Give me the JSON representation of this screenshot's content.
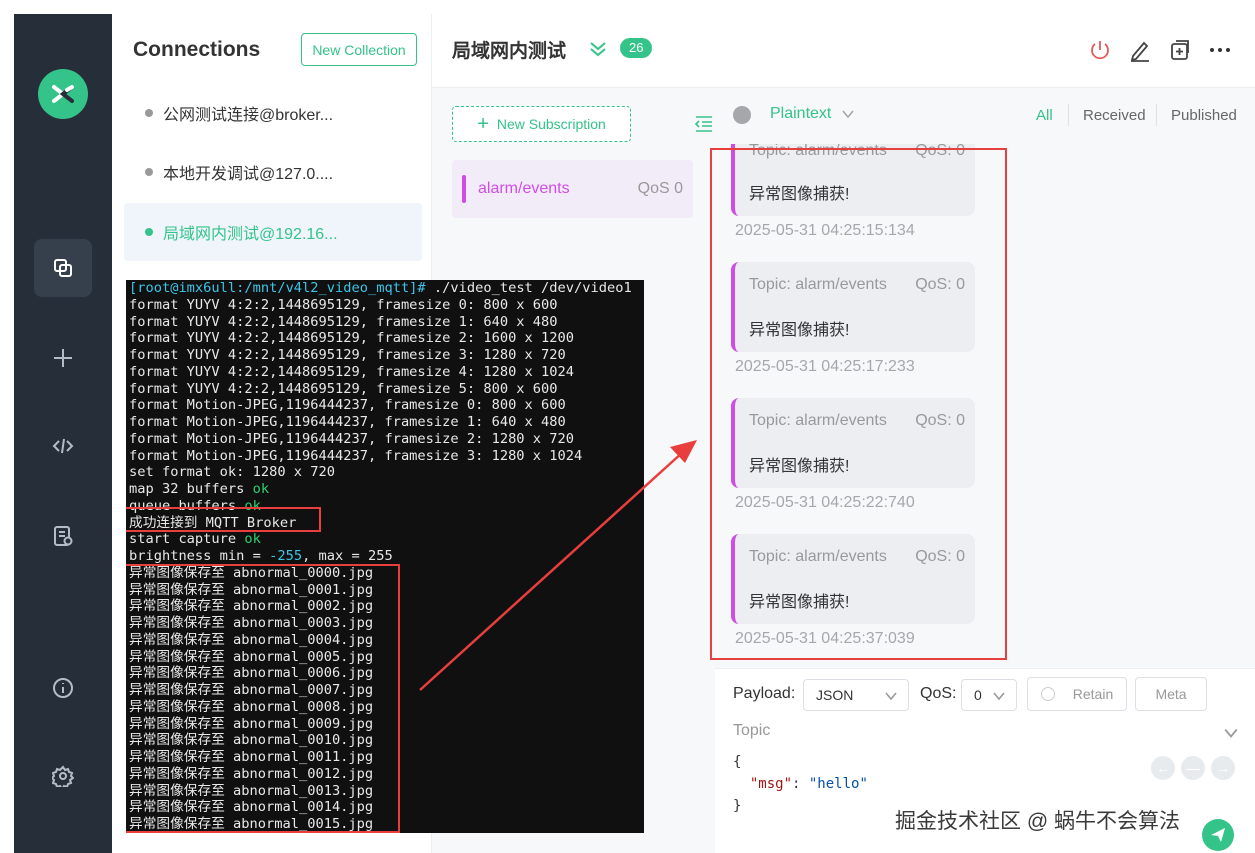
{
  "sidebar": {
    "logo": "mqttx-logo-icon",
    "nav": [
      "connections-icon",
      "plus-icon",
      "code-icon",
      "log-icon",
      "info-icon",
      "settings-icon"
    ]
  },
  "connections": {
    "title": "Connections",
    "new_collection": "New Collection",
    "items": [
      {
        "label": "公网测试连接@broker...",
        "status": "offline"
      },
      {
        "label": "本地开发调试@127.0....",
        "status": "offline"
      },
      {
        "label": "局域网内测试@192.16...",
        "status": "online",
        "active": true
      }
    ]
  },
  "header": {
    "title": "局域网内测试",
    "badge": "26",
    "actions": [
      "power-icon",
      "edit-icon",
      "new-window-icon",
      "more-icon"
    ]
  },
  "subscriptions": {
    "new_label": "New Subscription",
    "items": [
      {
        "topic": "alarm/events",
        "qos": "QoS 0",
        "color": "#cf4de6"
      }
    ]
  },
  "messages": {
    "format": "Plaintext",
    "filters": [
      "All",
      "Received",
      "Published"
    ],
    "active_filter": "All",
    "items": [
      {
        "topic": "Topic: alarm/events",
        "qos": "QoS: 0",
        "body": "异常图像捕获!",
        "time": "2025-05-31 04:25:15:134"
      },
      {
        "topic": "Topic: alarm/events",
        "qos": "QoS: 0",
        "body": "异常图像捕获!",
        "time": "2025-05-31 04:25:17:233"
      },
      {
        "topic": "Topic: alarm/events",
        "qos": "QoS: 0",
        "body": "异常图像捕获!",
        "time": "2025-05-31 04:25:22:740"
      },
      {
        "topic": "Topic: alarm/events",
        "qos": "QoS: 0",
        "body": "异常图像捕获!",
        "time": "2025-05-31 04:25:37:039"
      }
    ]
  },
  "composer": {
    "payload_label": "Payload:",
    "payload_format": "JSON",
    "qos_label": "QoS:",
    "qos_value": "0",
    "retain_label": "Retain",
    "meta_label": "Meta",
    "topic_placeholder": "Topic",
    "code_open": "{",
    "code_key": "\"msg\"",
    "code_colon": ": ",
    "code_value": "\"hello\"",
    "code_close": "}"
  },
  "watermark": "掘金技术社区 @ 蜗牛不会算法",
  "terminal": {
    "prompt": "[root@imx6ull:/mnt/v4l2_video_mqtt]#",
    "command": " ./video_test /dev/video1",
    "formats": [
      "format YUYV 4:2:2,1448695129, framesize 0: 800 x 600",
      "format YUYV 4:2:2,1448695129, framesize 1: 640 x 480",
      "format YUYV 4:2:2,1448695129, framesize 2: 1600 x 1200",
      "format YUYV 4:2:2,1448695129, framesize 3: 1280 x 720",
      "format YUYV 4:2:2,1448695129, framesize 4: 1280 x 1024",
      "format YUYV 4:2:2,1448695129, framesize 5: 800 x 600",
      "format Motion-JPEG,1196444237, framesize 0: 800 x 600",
      "format Motion-JPEG,1196444237, framesize 1: 640 x 480",
      "format Motion-JPEG,1196444237, framesize 2: 1280 x 720",
      "format Motion-JPEG,1196444237, framesize 3: 1280 x 1024",
      "set format ok: 1280 x 720"
    ],
    "map_text": "map 32 buffers ",
    "queue_text": "queue buffers ",
    "ok": "ok",
    "connect_text": "成功连接到 MQTT Broker",
    "start_text": "start capture ",
    "brightness_pre": "brightness min = ",
    "brightness_min": "-255",
    "brightness_post": ", max = 255",
    "saves": [
      "异常图像保存至 abnormal_0000.jpg",
      "异常图像保存至 abnormal_0001.jpg",
      "异常图像保存至 abnormal_0002.jpg",
      "异常图像保存至 abnormal_0003.jpg",
      "异常图像保存至 abnormal_0004.jpg",
      "异常图像保存至 abnormal_0005.jpg",
      "异常图像保存至 abnormal_0006.jpg",
      "异常图像保存至 abnormal_0007.jpg",
      "异常图像保存至 abnormal_0008.jpg",
      "异常图像保存至 abnormal_0009.jpg",
      "异常图像保存至 abnormal_0010.jpg",
      "异常图像保存至 abnormal_0011.jpg",
      "异常图像保存至 abnormal_0012.jpg",
      "异常图像保存至 abnormal_0013.jpg",
      "异常图像保存至 abnormal_0014.jpg",
      "异常图像保存至 abnormal_0015.jpg"
    ]
  },
  "colors": {
    "accent": "#34c388",
    "topic": "#cf4de6",
    "annotation": "#e83e3e",
    "rail": "#262e39"
  }
}
